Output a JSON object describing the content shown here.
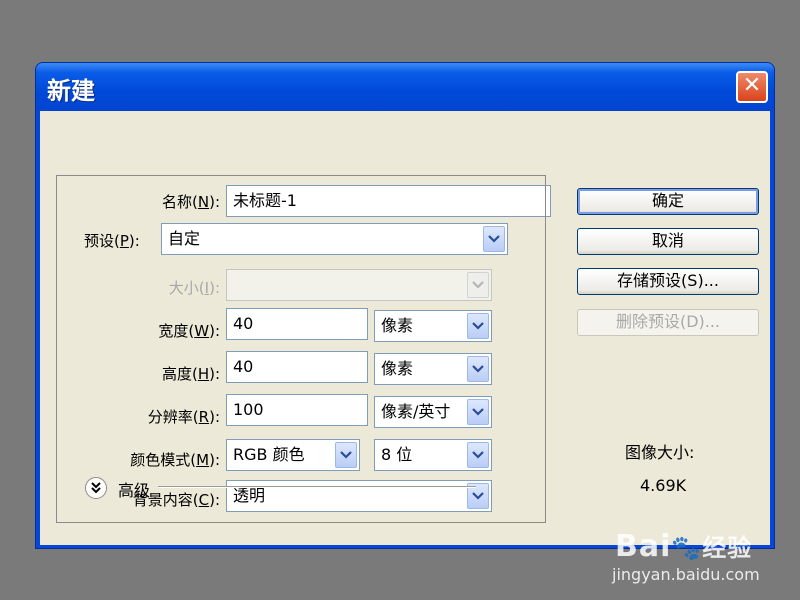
{
  "dialog": {
    "title": "新建",
    "close_glyph": "✕"
  },
  "fields": {
    "name": {
      "label_prefix": "名称(",
      "accel": "N",
      "label_suffix": "):",
      "value": "未标题-1"
    },
    "preset": {
      "label_prefix": "预设(",
      "accel": "P",
      "label_suffix": "):",
      "value": "自定"
    },
    "size": {
      "label_prefix": "大小(",
      "accel": "I",
      "label_suffix": "):",
      "value": ""
    },
    "width": {
      "label_prefix": "宽度(",
      "accel": "W",
      "label_suffix": "):",
      "value": "40",
      "unit": "像素"
    },
    "height": {
      "label_prefix": "高度(",
      "accel": "H",
      "label_suffix": "):",
      "value": "40",
      "unit": "像素"
    },
    "resolution": {
      "label_prefix": "分辨率(",
      "accel": "R",
      "label_suffix": "):",
      "value": "100",
      "unit": "像素/英寸"
    },
    "color_mode": {
      "label_prefix": "颜色模式(",
      "accel": "M",
      "label_suffix": "):",
      "value": "RGB 颜色",
      "depth": "8 位"
    },
    "background": {
      "label_prefix": "背景内容(",
      "accel": "C",
      "label_suffix": "):",
      "value": "透明"
    }
  },
  "advanced": {
    "label": "高级",
    "icon": "double-chevron-down-icon"
  },
  "buttons": {
    "ok": "确定",
    "cancel": "取消",
    "save_preset": "存储预设(S)...",
    "delete_preset": "删除预设(D)..."
  },
  "image_size": {
    "label": "图像大小:",
    "value": "4.69K"
  },
  "watermark": {
    "brand": "Bai",
    "brand2": "经验",
    "url": "jingyan.baidu.com"
  },
  "colors": {
    "title_bar": "#0054e3",
    "dialog_bg": "#ece9d8",
    "close_button": "#e0522a",
    "desktop": "#7a7a7a"
  }
}
